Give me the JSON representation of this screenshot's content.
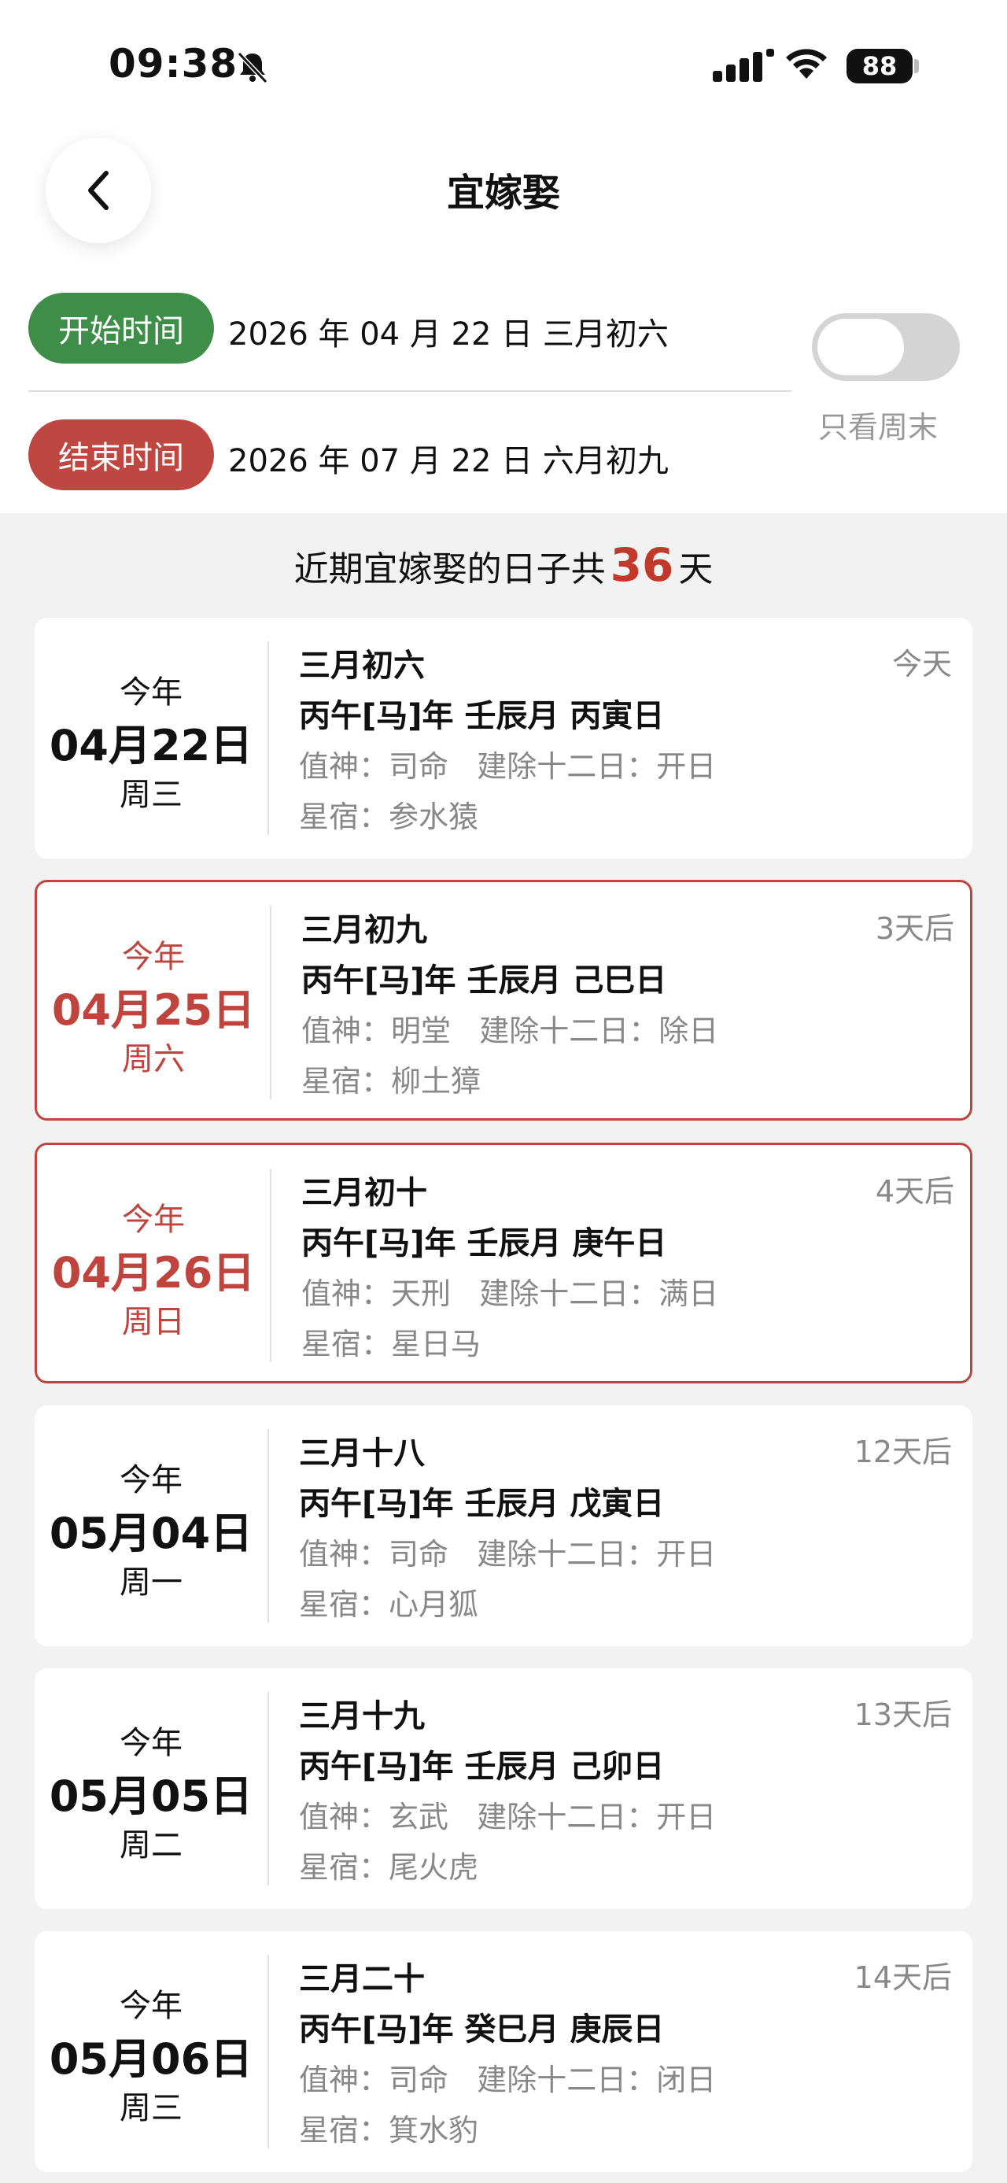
{
  "status_bar": {
    "time": "09:38",
    "battery": "88"
  },
  "header": {
    "title": "宜嫁娶"
  },
  "range": {
    "start_label": "开始时间",
    "start_value": "2026 年 04 月 22 日 三月初六",
    "end_label": "结束时间",
    "end_value": "2026 年 07 月 22 日 六月初九",
    "weekend_toggle_label": "只看周末",
    "weekend_only": false
  },
  "summary": {
    "prefix": "近期宜嫁娶的日子共",
    "count": "36",
    "suffix": "天"
  },
  "colors": {
    "start": "#3e8e4a",
    "end": "#bf4741",
    "accent": "#c0443e"
  },
  "days": [
    {
      "year": "今年",
      "date": "04月22日",
      "week": "周三",
      "lunar": "三月初六",
      "when": "今天",
      "ganzhi": "丙午[马]年 壬辰月 丙寅日",
      "god": "值神：司命   建除十二日：开日",
      "star": "星宿：参水猿",
      "highlight": false
    },
    {
      "year": "今年",
      "date": "04月25日",
      "week": "周六",
      "lunar": "三月初九",
      "when": "3天后",
      "ganzhi": "丙午[马]年 壬辰月 己巳日",
      "god": "值神：明堂   建除十二日：除日",
      "star": "星宿：柳土獐",
      "highlight": true
    },
    {
      "year": "今年",
      "date": "04月26日",
      "week": "周日",
      "lunar": "三月初十",
      "when": "4天后",
      "ganzhi": "丙午[马]年 壬辰月 庚午日",
      "god": "值神：天刑   建除十二日：满日",
      "star": "星宿：星日马",
      "highlight": true
    },
    {
      "year": "今年",
      "date": "05月04日",
      "week": "周一",
      "lunar": "三月十八",
      "when": "12天后",
      "ganzhi": "丙午[马]年 壬辰月 戊寅日",
      "god": "值神：司命   建除十二日：开日",
      "star": "星宿：心月狐",
      "highlight": false
    },
    {
      "year": "今年",
      "date": "05月05日",
      "week": "周二",
      "lunar": "三月十九",
      "when": "13天后",
      "ganzhi": "丙午[马]年 壬辰月 己卯日",
      "god": "值神：玄武   建除十二日：开日",
      "star": "星宿：尾火虎",
      "highlight": false
    },
    {
      "year": "今年",
      "date": "05月06日",
      "week": "周三",
      "lunar": "三月二十",
      "when": "14天后",
      "ganzhi": "丙午[马]年 癸巳月 庚辰日",
      "god": "值神：司命   建除十二日：闭日",
      "star": "星宿：箕水豹",
      "highlight": false
    }
  ]
}
